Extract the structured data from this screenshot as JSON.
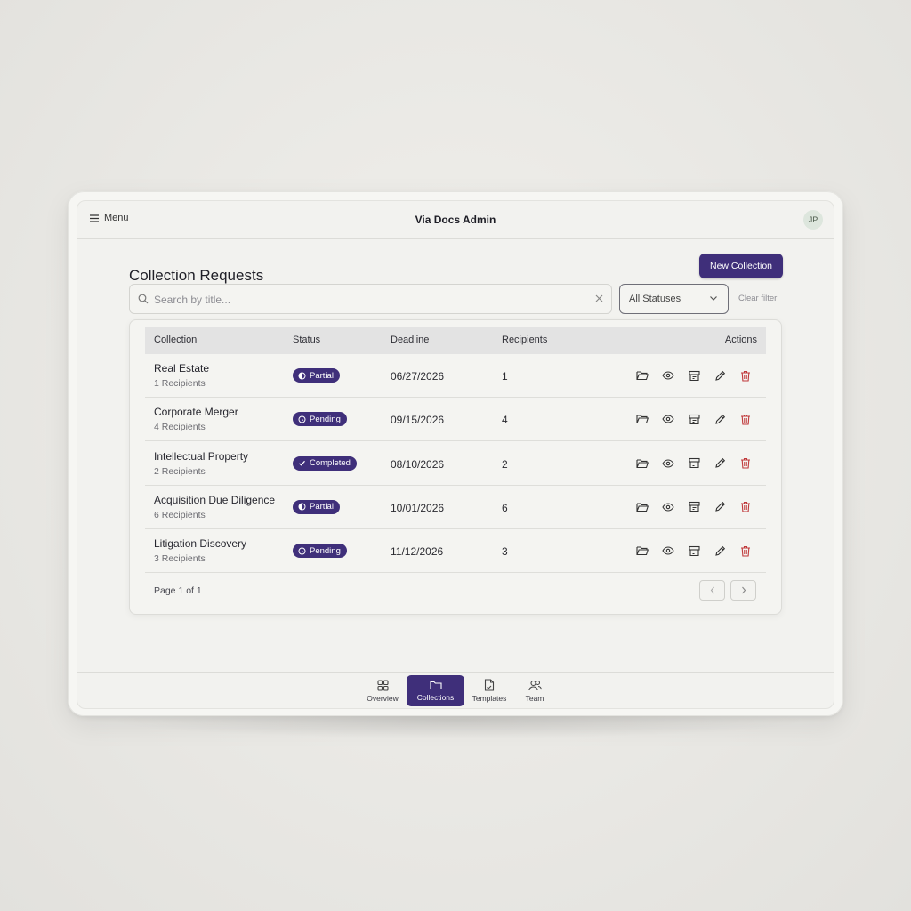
{
  "header": {
    "menu_label": "Menu",
    "title": "Via Docs Admin",
    "avatar_initials": "JP"
  },
  "page": {
    "title": "Collection Requests",
    "new_button": "New Collection"
  },
  "filters": {
    "search_placeholder": "Search by title...",
    "status_selected": "All Statuses",
    "clear_filter": "Clear filter"
  },
  "table": {
    "columns": [
      "Collection",
      "Status",
      "Deadline",
      "Recipients",
      "Actions"
    ],
    "rows": [
      {
        "name": "Real Estate",
        "sub": "1 Recipients",
        "status": "Partial",
        "status_icon": "half-circle-icon",
        "deadline": "06/27/2026",
        "recipients": "1"
      },
      {
        "name": "Corporate Merger",
        "sub": "4 Recipients",
        "status": "Pending",
        "status_icon": "clock-icon",
        "deadline": "09/15/2026",
        "recipients": "4"
      },
      {
        "name": "Intellectual Property",
        "sub": "2 Recipients",
        "status": "Completed",
        "status_icon": "check-icon",
        "deadline": "08/10/2026",
        "recipients": "2"
      },
      {
        "name": "Acquisition Due Diligence",
        "sub": "6 Recipients",
        "status": "Partial",
        "status_icon": "half-circle-icon",
        "deadline": "10/01/2026",
        "recipients": "6"
      },
      {
        "name": "Litigation Discovery",
        "sub": "3 Recipients",
        "status": "Pending",
        "status_icon": "clock-icon",
        "deadline": "11/12/2026",
        "recipients": "3"
      }
    ],
    "row_actions": [
      "folder-open-icon",
      "eye-icon",
      "archive-icon",
      "pencil-icon",
      "trash-icon"
    ],
    "pagination": "Page 1 of 1"
  },
  "bottom_nav": {
    "items": [
      {
        "label": "Overview",
        "icon": "grid-icon",
        "active": false
      },
      {
        "label": "Collections",
        "icon": "folder-icon",
        "active": true
      },
      {
        "label": "Templates",
        "icon": "document-icon",
        "active": false
      },
      {
        "label": "Team",
        "icon": "users-icon",
        "active": false
      }
    ]
  },
  "colors": {
    "accent": "#3f2f7a",
    "danger": "#c0393b",
    "background": "#f2f2ef"
  }
}
